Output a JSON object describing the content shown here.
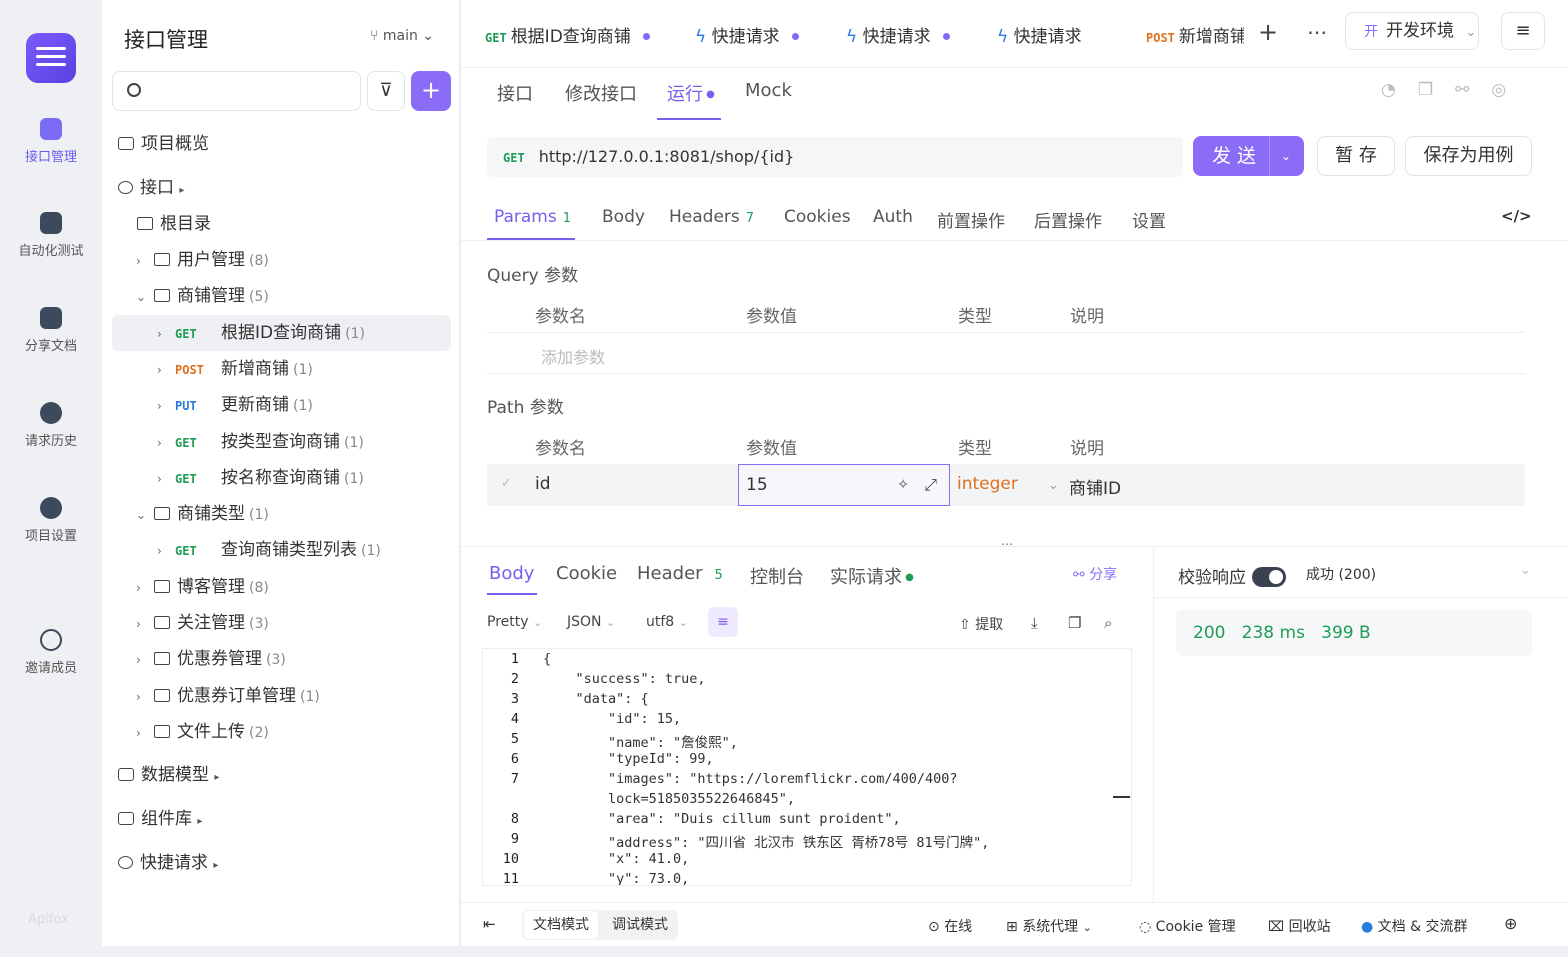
{
  "rail": {
    "items": [
      {
        "label": "接口管理",
        "icon": "api-icon"
      },
      {
        "label": "自动化测试",
        "icon": "automation-icon"
      },
      {
        "label": "分享文档",
        "icon": "book-icon"
      },
      {
        "label": "请求历史",
        "icon": "clock-icon"
      },
      {
        "label": "项目设置",
        "icon": "settings-icon"
      },
      {
        "label": "邀请成员",
        "icon": "invite-icon"
      }
    ],
    "brand": "Apifox"
  },
  "sidebar": {
    "title": "接口管理",
    "branch": "main",
    "overview": "项目概览",
    "api_root": "接口",
    "root_dir": "根目录",
    "tree": [
      {
        "type": "folder",
        "label": "用户管理",
        "count": "(8)",
        "open": false
      },
      {
        "type": "folder",
        "label": "商铺管理",
        "count": "(5)",
        "open": true
      },
      {
        "type": "api",
        "method": "GET",
        "label": "根据ID查询商铺",
        "count": "(1)",
        "selected": true
      },
      {
        "type": "api",
        "method": "POST",
        "label": "新增商铺",
        "count": "(1)"
      },
      {
        "type": "api",
        "method": "PUT",
        "label": "更新商铺",
        "count": "(1)"
      },
      {
        "type": "api",
        "method": "GET",
        "label": "按类型查询商铺",
        "count": "(1)"
      },
      {
        "type": "api",
        "method": "GET",
        "label": "按名称查询商铺",
        "count": "(1)"
      },
      {
        "type": "folder",
        "label": "商铺类型",
        "count": "(1)",
        "open": true
      },
      {
        "type": "api",
        "method": "GET",
        "label": "查询商铺类型列表",
        "count": "(1)"
      },
      {
        "type": "folder",
        "label": "博客管理",
        "count": "(8)",
        "open": false
      },
      {
        "type": "folder",
        "label": "关注管理",
        "count": "(3)",
        "open": false
      },
      {
        "type": "folder",
        "label": "优惠券管理",
        "count": "(3)",
        "open": false
      },
      {
        "type": "folder",
        "label": "优惠券订单管理",
        "count": "(1)",
        "open": false
      },
      {
        "type": "folder",
        "label": "文件上传",
        "count": "(2)",
        "open": false
      }
    ],
    "sections": [
      "数据模型",
      "组件库",
      "快捷请求"
    ]
  },
  "tabs": [
    {
      "method": "GET",
      "label": "根据ID查询商铺"
    },
    {
      "method": "",
      "label": "快捷请求"
    },
    {
      "method": "",
      "label": "快捷请求"
    },
    {
      "method": "",
      "label": "快捷请求"
    },
    {
      "method": "POST",
      "label": "新增商铺"
    }
  ],
  "env": "开发环境",
  "env_prefix": "开",
  "subtabs": [
    "接口",
    "修改接口",
    "运行",
    "Mock"
  ],
  "request": {
    "method": "GET",
    "url": "http://127.0.0.1:8081/shop/{id}",
    "send": "发 送",
    "save": "暂 存",
    "save_case": "保存为用例"
  },
  "param_tabs": [
    {
      "label": "Params",
      "count": "1"
    },
    {
      "label": "Body",
      "count": ""
    },
    {
      "label": "Headers",
      "count": "7"
    },
    {
      "label": "Cookies",
      "count": ""
    },
    {
      "label": "Auth",
      "count": ""
    },
    {
      "label": "前置操作",
      "count": ""
    },
    {
      "label": "后置操作",
      "count": ""
    },
    {
      "label": "设置",
      "count": ""
    }
  ],
  "query": {
    "title": "Query 参数",
    "cols": [
      "参数名",
      "参数值",
      "类型",
      "说明"
    ],
    "placeholder": "添加参数"
  },
  "path": {
    "title": "Path 参数",
    "cols": [
      "参数名",
      "参数值",
      "类型",
      "说明"
    ],
    "row": {
      "name": "id",
      "value": "15",
      "type": "integer",
      "desc": "商铺ID"
    }
  },
  "response": {
    "tabs": [
      {
        "label": "Body",
        "count": ""
      },
      {
        "label": "Cookie",
        "count": ""
      },
      {
        "label": "Header",
        "count": "5"
      },
      {
        "label": "控制台",
        "count": ""
      },
      {
        "label": "实际请求",
        "count": ""
      }
    ],
    "share": "分享",
    "format": [
      "Pretty",
      "JSON",
      "utf8"
    ],
    "extract": "提取",
    "validate": "校验响应",
    "result": "成功 (200)",
    "status": "200",
    "time": "238 ms",
    "size": "399 B",
    "lines": [
      {
        "n": "1",
        "t": "{"
      },
      {
        "n": "2",
        "t": "    \"success\": true,"
      },
      {
        "n": "3",
        "t": "    \"data\": {"
      },
      {
        "n": "4",
        "t": "        \"id\": 15,"
      },
      {
        "n": "5",
        "t": "        \"name\": \"詹俊熙\","
      },
      {
        "n": "6",
        "t": "        \"typeId\": 99,"
      },
      {
        "n": "7",
        "t": "        \"images\": \"https://loremflickr.com/400/400?"
      },
      {
        "n": "",
        "t": "        lock=5185035522646845\","
      },
      {
        "n": "8",
        "t": "        \"area\": \"Duis cillum sunt proident\","
      },
      {
        "n": "9",
        "t": "        \"address\": \"四川省 北汉市 铁东区 胥桥78号 81号门牌\","
      },
      {
        "n": "10",
        "t": "        \"x\": 41.0,"
      },
      {
        "n": "11",
        "t": "        \"y\": 73.0,"
      }
    ]
  },
  "footer": {
    "doc_mode": "文档模式",
    "debug_mode": "调试模式",
    "online": "在线",
    "proxy": "系统代理",
    "cookie": "Cookie 管理",
    "trash": "回收站",
    "docs": "文档 & 交流群"
  }
}
